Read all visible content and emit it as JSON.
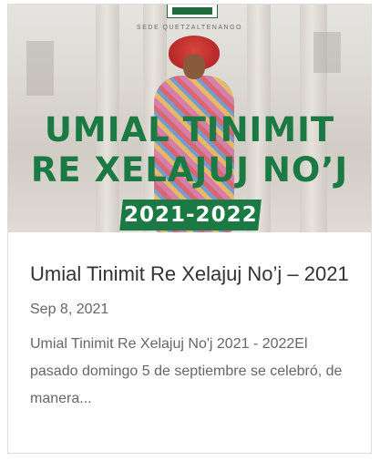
{
  "card": {
    "image": {
      "institution_caption": "SEDE QUETZALTENANGO",
      "headline_line1": "UMIAL TINIMIT",
      "headline_line2": "RE XELAJUJ NO’J",
      "year_badge": "2021-2022",
      "logo": "university-logo"
    },
    "title": "Umial Tinimit Re Xelajuj No’j – 2021",
    "date": "Sep 8, 2021",
    "excerpt": "Umial Tinimit Re Xelajuj No'j 2021 - 2022El pasado domingo 5 de septiembre se celebró, de manera..."
  },
  "colors": {
    "brand_green": "#1b7a43",
    "text_dark": "#333333",
    "text_muted": "#666666",
    "border": "#dcdcdc"
  }
}
